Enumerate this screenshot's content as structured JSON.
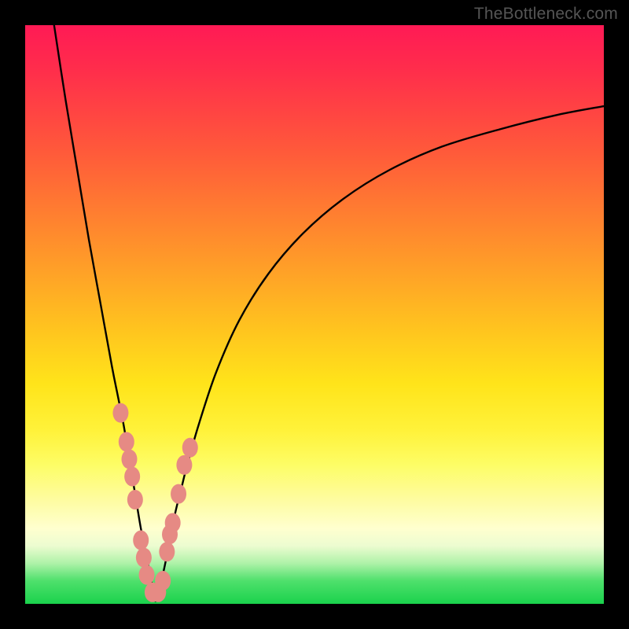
{
  "watermark": "TheBottleneck.com",
  "colors": {
    "frame": "#000000",
    "curve_stroke": "#000000",
    "marker_fill": "#e68a84",
    "marker_stroke": "#c76a65",
    "gradient_top": "#ff1a55",
    "gradient_bottom": "#1ad24c"
  },
  "chart_data": {
    "type": "line",
    "title": "",
    "xlabel": "",
    "ylabel": "",
    "xlim": [
      0,
      100
    ],
    "ylim": [
      0,
      100
    ],
    "curve": {
      "name": "bottleneck-curve",
      "minimum_x": 22.5,
      "x": [
        5,
        7,
        9,
        11,
        13,
        15,
        16,
        17,
        18,
        19,
        20,
        21,
        22,
        22.5,
        23,
        24,
        25,
        26,
        27,
        28,
        30,
        33,
        37,
        42,
        48,
        55,
        63,
        72,
        82,
        92,
        100
      ],
      "y": [
        100,
        87,
        75,
        63,
        52,
        41,
        36,
        31,
        25,
        19,
        13,
        8,
        3,
        0.5,
        2,
        6,
        11,
        16,
        20,
        24,
        31,
        40,
        49,
        57,
        64,
        70,
        75,
        79,
        82,
        84.5,
        86
      ]
    },
    "markers": {
      "name": "data-points",
      "points": [
        {
          "x": 16.5,
          "y": 33
        },
        {
          "x": 17.5,
          "y": 28
        },
        {
          "x": 18,
          "y": 25
        },
        {
          "x": 18.5,
          "y": 22
        },
        {
          "x": 19,
          "y": 18
        },
        {
          "x": 20,
          "y": 11
        },
        {
          "x": 20.5,
          "y": 8
        },
        {
          "x": 21,
          "y": 5
        },
        {
          "x": 22,
          "y": 2
        },
        {
          "x": 23,
          "y": 2
        },
        {
          "x": 23.8,
          "y": 4
        },
        {
          "x": 24.5,
          "y": 9
        },
        {
          "x": 25,
          "y": 12
        },
        {
          "x": 25.5,
          "y": 14
        },
        {
          "x": 26.5,
          "y": 19
        },
        {
          "x": 27.5,
          "y": 24
        },
        {
          "x": 28.5,
          "y": 27
        }
      ],
      "radius": 10
    }
  }
}
